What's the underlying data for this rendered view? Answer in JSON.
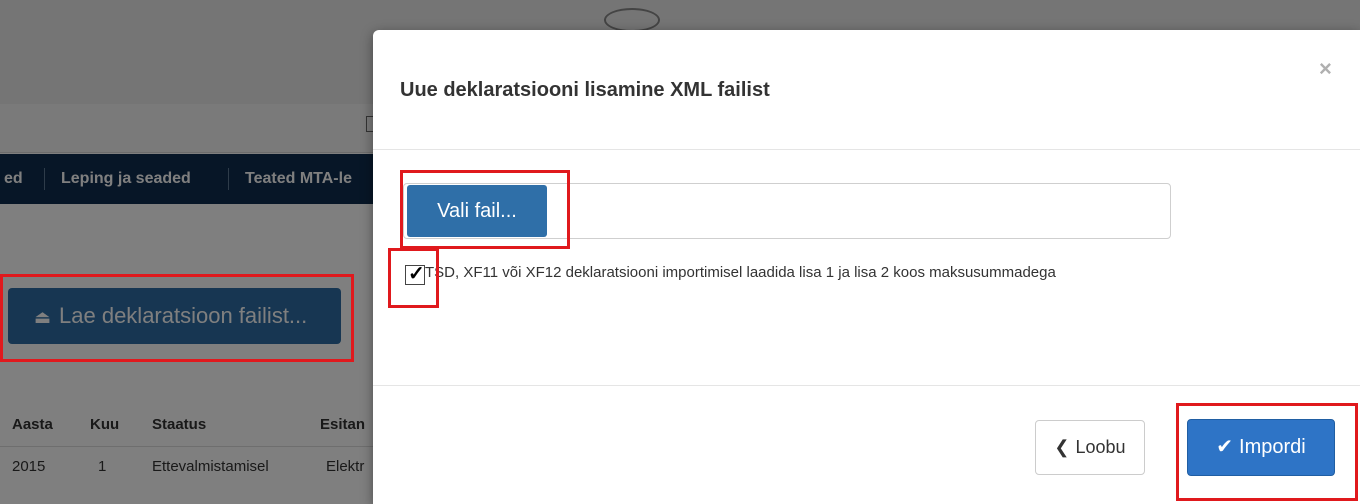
{
  "background": {
    "nav_items": [
      "ed",
      "Leping ja seaded",
      "Teated MTA-le"
    ],
    "upload_button": "Lae deklaratsioon failist...",
    "table_headers": [
      "Aasta",
      "Kuu",
      "Staatus",
      "Esitan"
    ],
    "table_row": [
      "2015",
      "1",
      "Ettevalmistamisel",
      "Elektr"
    ]
  },
  "modal": {
    "title": "Uue deklaratsiooni lisamine XML failist",
    "close": "×",
    "file_button": "Vali fail...",
    "checkbox_label": "TSD, XF11 või XF12 deklaratsiooni importimisel laadida lisa 1 ja lisa 2 koos maksusummadega",
    "checkbox_checked": true,
    "cancel_button": "Loobu",
    "import_button": "Impordi"
  },
  "icons": {
    "upload": "upload-icon",
    "checkmark": "checkmark-icon",
    "chevron_left": "chevron-left-icon"
  },
  "colors": {
    "highlight": "#e0191d",
    "primary": "#2e74c6",
    "nav": "#0f2d4f"
  }
}
